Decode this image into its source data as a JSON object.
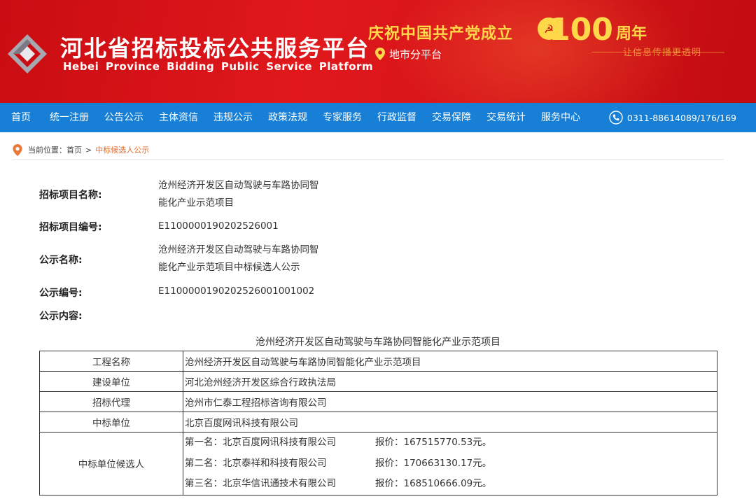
{
  "header": {
    "site_name_cn": "河北省招标投标公共服务平台",
    "site_name_en": "Hebei Province Bidding Public Service Platform",
    "celebrate_text": "庆祝中国共产党成立",
    "anniversary_number": "100",
    "anniversary_suffix": "周年",
    "sub_platform": "地市分平台",
    "slogan": "让信息传播更透明",
    "colors": {
      "banner_red": "#d41418",
      "gold": "#ffd84a"
    }
  },
  "nav": {
    "items": [
      "首页",
      "统一注册",
      "公告公示",
      "主体资信",
      "违规公示",
      "政策法规",
      "专家服务",
      "行政监督",
      "交易保障",
      "交易统计",
      "服务中心"
    ],
    "phone": "0311-88614089/176/169",
    "color": "#1780d6"
  },
  "breadcrumb": {
    "prefix": "当前位置：",
    "home": "首页",
    "separator": ">",
    "current": "中标候选人公示"
  },
  "fields": {
    "project_name_label": "招标项目名称:",
    "project_name_line1": "沧州经济开发区自动驾驶与车路协同智",
    "project_name_line2": "能化产业示范项目",
    "project_code_label": "招标项目编号:",
    "project_code": "E1100000190202526001",
    "notice_name_label": "公示名称:",
    "notice_name_line1": "沧州经济开发区自动驾驶与车路协同智",
    "notice_name_line2": "能化产业示范项目中标候选人公示",
    "notice_code_label": "公示编号:",
    "notice_code": "E1100000190202526001001002",
    "notice_content_label": "公示内容:"
  },
  "content": {
    "title": "沧州经济开发区自动驾驶与车路协同智能化产业示范项目",
    "table": {
      "project_label": "工程名称",
      "project_value": "沧州经济开发区自动驾驶与车路协同智能化产业示范项目",
      "owner_label": "建设单位",
      "owner_value": "河北沧州经济开发区综合行政执法局",
      "agent_label": "招标代理",
      "agent_value": "沧州市仁泰工程招标咨询有限公司",
      "winner_label": "中标单位",
      "winner_value": "北京百度网讯科技有限公司",
      "candidates_label": "中标单位候选人",
      "candidates": [
        {
          "name": "第一名：北京百度网讯科技有限公司",
          "price": "报价：167515770.53元。"
        },
        {
          "name": "第二名：北京泰祥和科技有限公司",
          "price": "报价：170663130.17元。"
        },
        {
          "name": "第三名：北京华信讯通技术有限公司",
          "price": "报价：168510666.09元。"
        }
      ]
    }
  }
}
